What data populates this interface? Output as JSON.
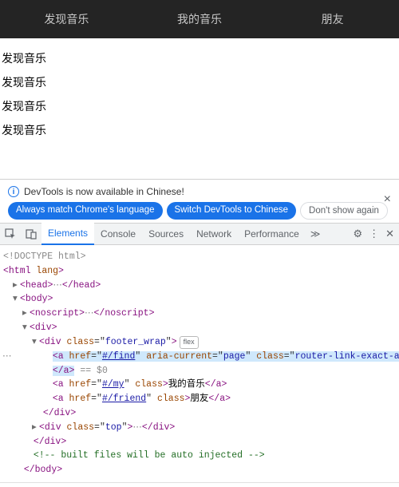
{
  "nav": {
    "items": [
      "发现音乐",
      "我的音乐",
      "朋友"
    ]
  },
  "content": {
    "lines": [
      "发现音乐",
      "发现音乐",
      "发现音乐",
      "发现音乐"
    ]
  },
  "banner": {
    "message": "DevTools is now available in Chinese!",
    "btn_always": "Always match Chrome's language",
    "btn_switch": "Switch DevTools to Chinese",
    "btn_dont": "Don't show again",
    "close": "×"
  },
  "devtools": {
    "tabs": [
      "Elements",
      "Console",
      "Sources",
      "Network",
      "Performance"
    ],
    "selected_tab": "Elements",
    "more": "≫"
  },
  "dom": {
    "doctype": "<!DOCTYPE html>",
    "html_open": "html",
    "lang_attr": "lang",
    "head": "head",
    "body": "body",
    "noscript": "noscript",
    "div": "div",
    "a": "a",
    "class_attr": "class",
    "href_attr": "href",
    "aria_attr": "aria-current",
    "footer_wrap": "footer_wrap",
    "flex_badge": "flex",
    "href_find": "#/find",
    "href_my": "#/my",
    "href_friend": "#/friend",
    "aria_page": "page",
    "rl_classes": "router-link-exact-active router-link-active",
    "text_find": "发现音乐",
    "text_my": "我的音乐",
    "text_friend": "朋友",
    "top_class": "top",
    "eq_dollar0": " == $0",
    "comment": " built files will be auto injected ",
    "ellipsis": "…",
    "ellipsis3": "⋯"
  }
}
